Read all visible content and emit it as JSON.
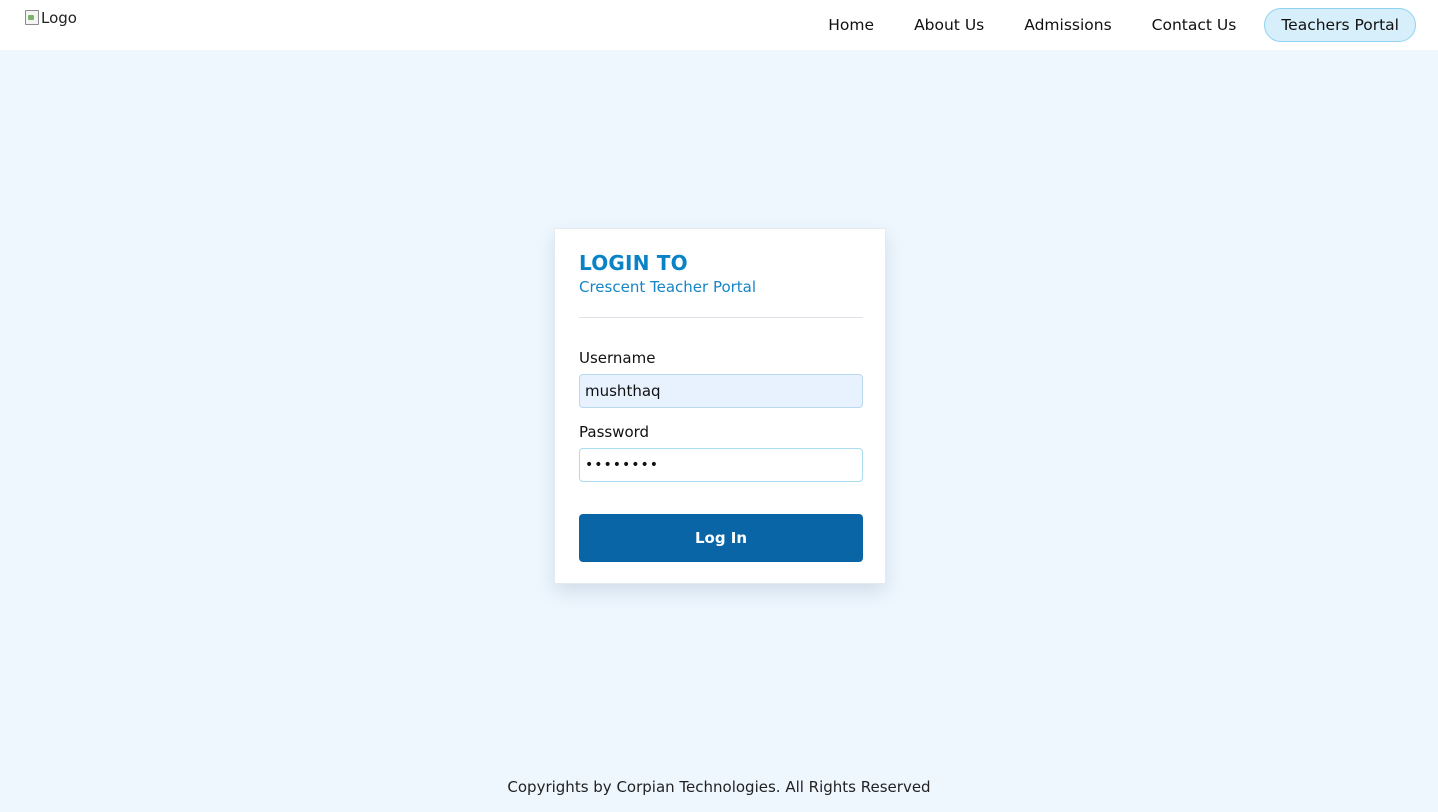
{
  "navbar": {
    "logo_alt": "Logo",
    "links": [
      {
        "label": "Home"
      },
      {
        "label": "About Us"
      },
      {
        "label": "Admissions"
      },
      {
        "label": "Contact Us"
      },
      {
        "label": "Teachers Portal",
        "active": true
      }
    ]
  },
  "login_card": {
    "title": "LOGIN TO",
    "subtitle": "Crescent Teacher Portal",
    "username_label": "Username",
    "username_value": "mushthaq",
    "password_label": "Password",
    "password_value": "••••••••",
    "submit_label": "Log In"
  },
  "footer": {
    "text": "Copyrights by Corpian Technologies. All Rights Reserved"
  },
  "colors": {
    "page_background": "#eef7fe",
    "accent_blue": "#0a82c5",
    "button_blue": "#0a65a6",
    "active_nav_bg": "#d7effb"
  },
  "icons": {
    "logo": "broken-image-icon"
  }
}
